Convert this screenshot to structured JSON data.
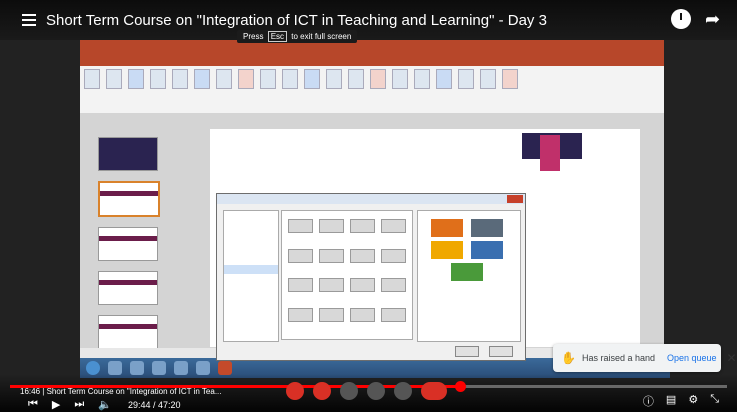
{
  "video": {
    "title": "Short Term Course on \"Integration of ICT in Teaching and Learning\" - Day 3",
    "escape_tip": {
      "prefix": "Press",
      "key": "Esc",
      "suffix": "to exit full screen"
    }
  },
  "notification": {
    "text": "Has raised a hand",
    "action": "Open queue",
    "close": "✕"
  },
  "player": {
    "current_time": "29:44",
    "total_time": "47:20",
    "time_display": "29:44 / 47:20",
    "progress_fraction": 0.628,
    "info_time": "16:46",
    "info_title": "Short Term Course on \"Integration of ICT in Tea..."
  },
  "icons": {
    "menu": "menu-icon",
    "clock": "clock-icon",
    "share": "share-icon",
    "play": "play-icon",
    "prev": "previous-icon",
    "next": "next-icon",
    "volume": "volume-icon",
    "hand": "raised-hand-icon"
  },
  "colors": {
    "youtube_red": "#ff0000",
    "powerpoint_brand": "#b7472a",
    "meet_red": "#d93025",
    "link_blue": "#1a73e8"
  }
}
